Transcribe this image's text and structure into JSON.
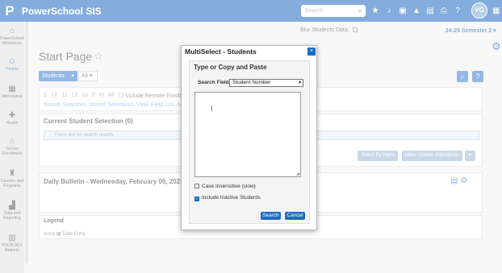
{
  "header": {
    "app_title": "PowerSchool SIS",
    "search_placeholder": "Search",
    "user_initials": "VG",
    "icons": [
      "star-icon",
      "bell-icon",
      "pages-icon",
      "warning-icon",
      "document-icon",
      "print-icon",
      "help-icon"
    ]
  },
  "subheader": {
    "blur_label": "Blur Students Data:",
    "term": "24-25 Semester 2"
  },
  "nav": {
    "items": [
      {
        "label": "PowerSchool Resources",
        "icon": "home-icon"
      },
      {
        "label": "People",
        "icon": "people-icon"
      },
      {
        "label": "Attendance",
        "icon": "attendance-icon"
      },
      {
        "label": "Health",
        "icon": "health-icon"
      },
      {
        "label": "School Enrollment",
        "icon": "enrollment-icon"
      },
      {
        "label": "Courses and Programs",
        "icon": "courses-icon"
      },
      {
        "label": "Data and Reporting",
        "icon": "chart-icon"
      },
      {
        "label": "PSCB DEV Reports",
        "icon": "reports-icon"
      }
    ]
  },
  "page": {
    "title": "Start Page",
    "students_button": "Students",
    "all_select": "All",
    "grades": "S 10 11 12 13 F M All",
    "remote_label": "Include Remote Enrollm",
    "links": "Stored Searches  Stored Selections  View Field List  Advance",
    "selection_title": "Current Student Selection (0)",
    "no_results": "There are no search results.",
    "select_by_hand": "Select By Hand",
    "mass_update": "Mass Update Attendance",
    "bulletin_title": "Daily Bulletin - Wednesday, February 05, 2025",
    "legend_title": "Legend",
    "legend_icons": "Icons",
    "legend_date_entry": "Date Entry"
  },
  "dialog": {
    "title": "MultiSelect - Students",
    "close": "×",
    "subtitle": "Type or Copy and Paste",
    "search_field_label": "Search Field",
    "search_field_value": "Student Number",
    "paste_value": "",
    "case_insensitive_label": "Case Insensitive (slow)",
    "case_insensitive_checked": false,
    "include_inactive_label": "Include Inactive Students",
    "include_inactive_checked": true,
    "search_button": "Search",
    "cancel_button": "Cancel"
  }
}
